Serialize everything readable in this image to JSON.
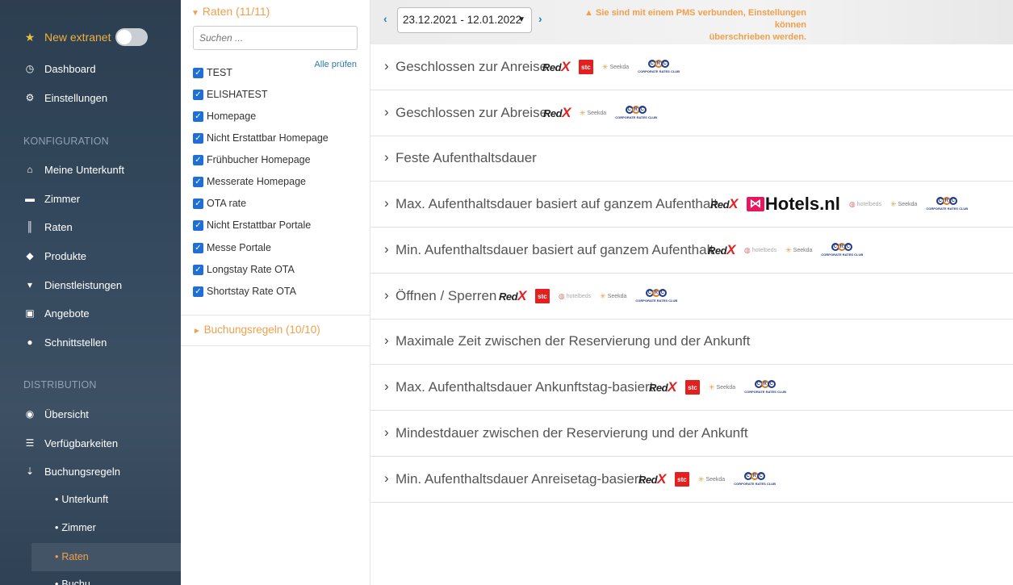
{
  "sidebar": {
    "new_extranet": {
      "label": "New extranet",
      "icon": "star-icon"
    },
    "top_items": [
      {
        "label": "Dashboard",
        "icon": "dashboard-icon"
      },
      {
        "label": "Einstellungen",
        "icon": "gear-icon"
      }
    ],
    "sections": [
      {
        "heading": "KONFIGURATION",
        "items": [
          {
            "label": "Meine Unterkunft",
            "icon": "home-icon"
          },
          {
            "label": "Zimmer",
            "icon": "bed-icon"
          },
          {
            "label": "Raten",
            "icon": "barcode-icon"
          },
          {
            "label": "Produkte",
            "icon": "tags-icon"
          },
          {
            "label": "Dienstleistungen",
            "icon": "cart-icon"
          },
          {
            "label": "Angebote",
            "icon": "gift-icon"
          },
          {
            "label": "Schnittstellen",
            "icon": "globe-icon"
          }
        ]
      },
      {
        "heading": "DISTRIBUTION",
        "items": [
          {
            "label": "Übersicht",
            "icon": "eye-icon"
          },
          {
            "label": "Verfügbarkeiten",
            "icon": "server-icon"
          },
          {
            "label": "Buchungsregeln",
            "icon": "sort-icon"
          }
        ]
      }
    ],
    "subitems": [
      "Unterkunft",
      "Zimmer",
      "Raten",
      "Buchu..."
    ],
    "active_subitem": "Raten"
  },
  "filter": {
    "title": "Raten (11/11)",
    "search_placeholder": "Suchen ...",
    "check_all": "Alle prüfen",
    "rates": [
      "TEST",
      "ELISHATEST",
      "Homepage",
      "Nicht Erstattbar Homepage",
      "Frühbucher Homepage",
      "Messerate Homepage",
      "OTA rate",
      "Nicht Erstattbar Portale",
      "Messe Portale",
      "Longstay Rate OTA",
      "Shortstay Rate OTA"
    ],
    "rules_title": "Buchungsregeln (10/10)"
  },
  "topbar": {
    "date_range": "23.12.2021 - 12.01.2022",
    "warning_line1": "Sie sind mit einem PMS verbunden, Einstellungen können",
    "warning_line2": "überschrieben werden."
  },
  "rules": [
    {
      "label": "Geschlossen zur Anreise",
      "logos": [
        "redx",
        "stc",
        "seekda",
        "crc"
      ]
    },
    {
      "label": "Geschlossen zur Abreise",
      "logos": [
        "redx",
        "seekda",
        "crc"
      ]
    },
    {
      "label": "Feste Aufenthaltsdauer",
      "logos": []
    },
    {
      "label": "Max. Aufenthaltsdauer basiert auf ganzem Aufenthalt",
      "logos": [
        "redx",
        "hotelsnl",
        "hotelbeds",
        "seekda",
        "crc"
      ]
    },
    {
      "label": "Min. Aufenthaltsdauer basiert auf ganzem Aufenthalt",
      "logos": [
        "redx",
        "hotelbeds",
        "seekda",
        "crc"
      ]
    },
    {
      "label": "Öffnen / Sperren",
      "logos": [
        "redx",
        "stc",
        "hotelbeds",
        "seekda",
        "crc"
      ]
    },
    {
      "label": "Maximale Zeit zwischen der Reservierung und der Ankunft",
      "logos": []
    },
    {
      "label": "Max. Aufenthaltsdauer Ankunftstag-basiert",
      "logos": [
        "redx",
        "stc",
        "seekda",
        "crc"
      ]
    },
    {
      "label": "Mindestdauer zwischen der Reservierung und der Ankunft",
      "logos": []
    },
    {
      "label": "Min. Aufenthaltsdauer Anreisetag-basiert",
      "logos": [
        "redx",
        "stc",
        "seekda",
        "crc"
      ]
    }
  ],
  "logo_text": {
    "redx": "Red",
    "stc": "stc",
    "seekda": "Seekda",
    "hotelbeds": "hotelbeds",
    "hotelsnl": "Hotels.nl",
    "crc": "CORPORATE RATES CLUB"
  },
  "colors": {
    "accent_orange": "#f0a04b",
    "link_blue": "#1b82c5",
    "checkbox_blue": "#1f6fd6",
    "sidebar_bg": "#2c3e50"
  }
}
